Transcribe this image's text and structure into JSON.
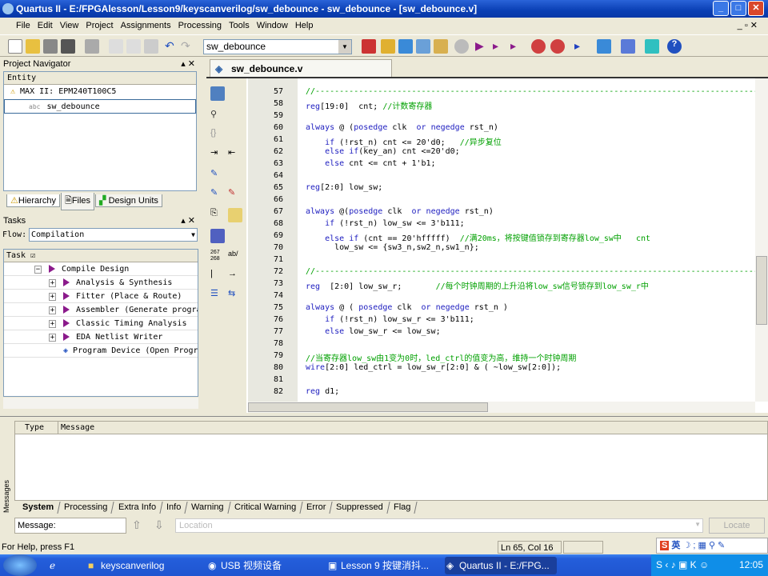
{
  "window": {
    "title": "Quartus II - E:/FPGAlesson/Lesson9/keyscanverilog/sw_debounce - sw_debounce - [sw_debounce.v]"
  },
  "menu": [
    "File",
    "Edit",
    "View",
    "Project",
    "Assignments",
    "Processing",
    "Tools",
    "Window",
    "Help"
  ],
  "toolbar": {
    "project_selector": "sw_debounce"
  },
  "project_navigator": {
    "title": "Project Navigator",
    "column": "Entity",
    "device": "MAX II: EPM240T100C5",
    "entity": "sw_debounce",
    "tabs": [
      "Hierarchy",
      "Files",
      "Design Units"
    ]
  },
  "tasks": {
    "title": "Tasks",
    "flow_label": "Flow:",
    "flow_value": "Compilation",
    "column": "Task",
    "items": [
      {
        "label": "Compile Design",
        "level": 0,
        "expander": "−"
      },
      {
        "label": "Analysis & Synthesis",
        "level": 1,
        "expander": "+"
      },
      {
        "label": "Fitter (Place & Route)",
        "level": 1,
        "expander": "+"
      },
      {
        "label": "Assembler (Generate programming files)",
        "level": 1,
        "expander": "+"
      },
      {
        "label": "Classic Timing Analysis",
        "level": 1,
        "expander": "+"
      },
      {
        "label": "EDA Netlist Writer",
        "level": 1,
        "expander": "+"
      },
      {
        "label": "Program Device (Open Programmer)",
        "level": -1,
        "expander": ""
      }
    ]
  },
  "editor": {
    "tab": "sw_debounce.v",
    "lines": [
      {
        "n": "57",
        "seg": [
          [
            "//--------------------------------------------------------------------------------------------------",
            "cm"
          ]
        ]
      },
      {
        "n": "58",
        "seg": [
          [
            "reg",
            "kw"
          ],
          [
            "[19:0]  cnt; ",
            ""
          ],
          [
            "//计数寄存器",
            "cm"
          ]
        ]
      },
      {
        "n": "59",
        "seg": []
      },
      {
        "n": "60",
        "seg": [
          [
            "always",
            "kw"
          ],
          [
            " @ (",
            ""
          ],
          [
            "posedge",
            "kw"
          ],
          [
            " clk  ",
            ""
          ],
          [
            "or",
            "kw"
          ],
          [
            " ",
            ""
          ],
          [
            "negedge",
            "kw"
          ],
          [
            " rst_n)",
            ""
          ]
        ]
      },
      {
        "n": "61",
        "seg": [
          [
            "    ",
            ""
          ],
          [
            "if",
            "kw"
          ],
          [
            " (!rst_n) cnt <= 20'd0;   ",
            ""
          ],
          [
            "//异步复位",
            "cm"
          ]
        ]
      },
      {
        "n": "62",
        "seg": [
          [
            "    ",
            ""
          ],
          [
            "else if",
            "kw"
          ],
          [
            "(key_an) cnt <=20'd0;",
            ""
          ]
        ]
      },
      {
        "n": "63",
        "seg": [
          [
            "    ",
            ""
          ],
          [
            "else",
            "kw"
          ],
          [
            " cnt <= cnt + 1'b1;",
            ""
          ]
        ]
      },
      {
        "n": "64",
        "seg": []
      },
      {
        "n": "65",
        "seg": [
          [
            "reg",
            "kw"
          ],
          [
            "[2:0] low_sw;",
            ""
          ]
        ]
      },
      {
        "n": "66",
        "seg": []
      },
      {
        "n": "67",
        "seg": [
          [
            "always",
            "kw"
          ],
          [
            " @(",
            ""
          ],
          [
            "posedge",
            "kw"
          ],
          [
            " clk  ",
            ""
          ],
          [
            "or",
            "kw"
          ],
          [
            " ",
            ""
          ],
          [
            "negedge",
            "kw"
          ],
          [
            " rst_n)",
            ""
          ]
        ]
      },
      {
        "n": "68",
        "seg": [
          [
            "    ",
            ""
          ],
          [
            "if",
            "kw"
          ],
          [
            " (!rst_n) low_sw <= 3'b111;",
            ""
          ]
        ]
      },
      {
        "n": "69",
        "seg": [
          [
            "    ",
            ""
          ],
          [
            "else if",
            "kw"
          ],
          [
            " (cnt == 20'hfffff)  ",
            ""
          ],
          [
            "//满20ms，将按键值锁存到寄存器low_sw中   cnt",
            "cm"
          ]
        ]
      },
      {
        "n": "70",
        "seg": [
          [
            "      low_sw <= {sw3_n,sw2_n,sw1_n};",
            ""
          ]
        ]
      },
      {
        "n": "71",
        "seg": []
      },
      {
        "n": "72",
        "seg": [
          [
            "//--------------------------------------------------------------------------------------------------",
            "cm"
          ]
        ]
      },
      {
        "n": "73",
        "seg": [
          [
            "reg",
            "kw"
          ],
          [
            "  [2:0] low_sw_r;       ",
            ""
          ],
          [
            "//每个时钟周期的上升沿将low_sw信号锁存到low_sw_r中",
            "cm"
          ]
        ]
      },
      {
        "n": "74",
        "seg": []
      },
      {
        "n": "75",
        "seg": [
          [
            "always",
            "kw"
          ],
          [
            " @ ( ",
            ""
          ],
          [
            "posedge",
            "kw"
          ],
          [
            " clk  ",
            ""
          ],
          [
            "or",
            "kw"
          ],
          [
            " ",
            ""
          ],
          [
            "negedge",
            "kw"
          ],
          [
            " rst_n )",
            ""
          ]
        ]
      },
      {
        "n": "76",
        "seg": [
          [
            "    ",
            ""
          ],
          [
            "if",
            "kw"
          ],
          [
            " (!rst_n) low_sw_r <= 3'b111;",
            ""
          ]
        ]
      },
      {
        "n": "77",
        "seg": [
          [
            "    ",
            ""
          ],
          [
            "else",
            "kw"
          ],
          [
            " low_sw_r <= low_sw;",
            ""
          ]
        ]
      },
      {
        "n": "78",
        "seg": []
      },
      {
        "n": "79",
        "seg": [
          [
            "//当寄存器low_sw由1变为0时，led_ctrl的值变为高，维持一个时钟周期",
            "cm"
          ]
        ]
      },
      {
        "n": "80",
        "seg": [
          [
            "wire",
            "kw"
          ],
          [
            "[2:0] led_ctrl = low_sw_r[2:0] & ( ~low_sw[2:0]);",
            ""
          ]
        ]
      },
      {
        "n": "81",
        "seg": []
      },
      {
        "n": "82",
        "seg": [
          [
            "reg",
            "kw"
          ],
          [
            " d1;",
            ""
          ]
        ]
      }
    ]
  },
  "messages": {
    "side_label": "Messages",
    "col_type": "Type",
    "col_message": "Message",
    "tabs": [
      "System",
      "Processing",
      "Extra Info",
      "Info",
      "Warning",
      "Critical Warning",
      "Error",
      "Suppressed",
      "Flag"
    ],
    "message_label": "Message:",
    "location_placeholder": "Location",
    "locate_button": "Locate"
  },
  "status": {
    "help": "For Help, press F1",
    "position": "Ln 65, Col 16",
    "ime": "英"
  },
  "taskbar": {
    "items": [
      "keyscanverilog",
      "USB 视频设备",
      "Lesson 9 按键消抖...",
      "Quartus II - E:/FPG..."
    ],
    "clock": "12:05"
  }
}
